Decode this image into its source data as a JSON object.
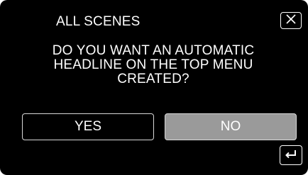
{
  "dialog": {
    "title": "ALL SCENES",
    "message": "DO YOU WANT AN AUTOMATIC\nHEADLINE ON THE TOP MENU\nCREATED?",
    "yes_label": "YES",
    "no_label": "NO"
  },
  "icons": {
    "close": "close-icon",
    "back": "return-icon"
  },
  "colors": {
    "background": "#000000",
    "text": "#ffffff",
    "no_button_fill": "#9a9a9a",
    "button_border": "#d8d8d8"
  }
}
